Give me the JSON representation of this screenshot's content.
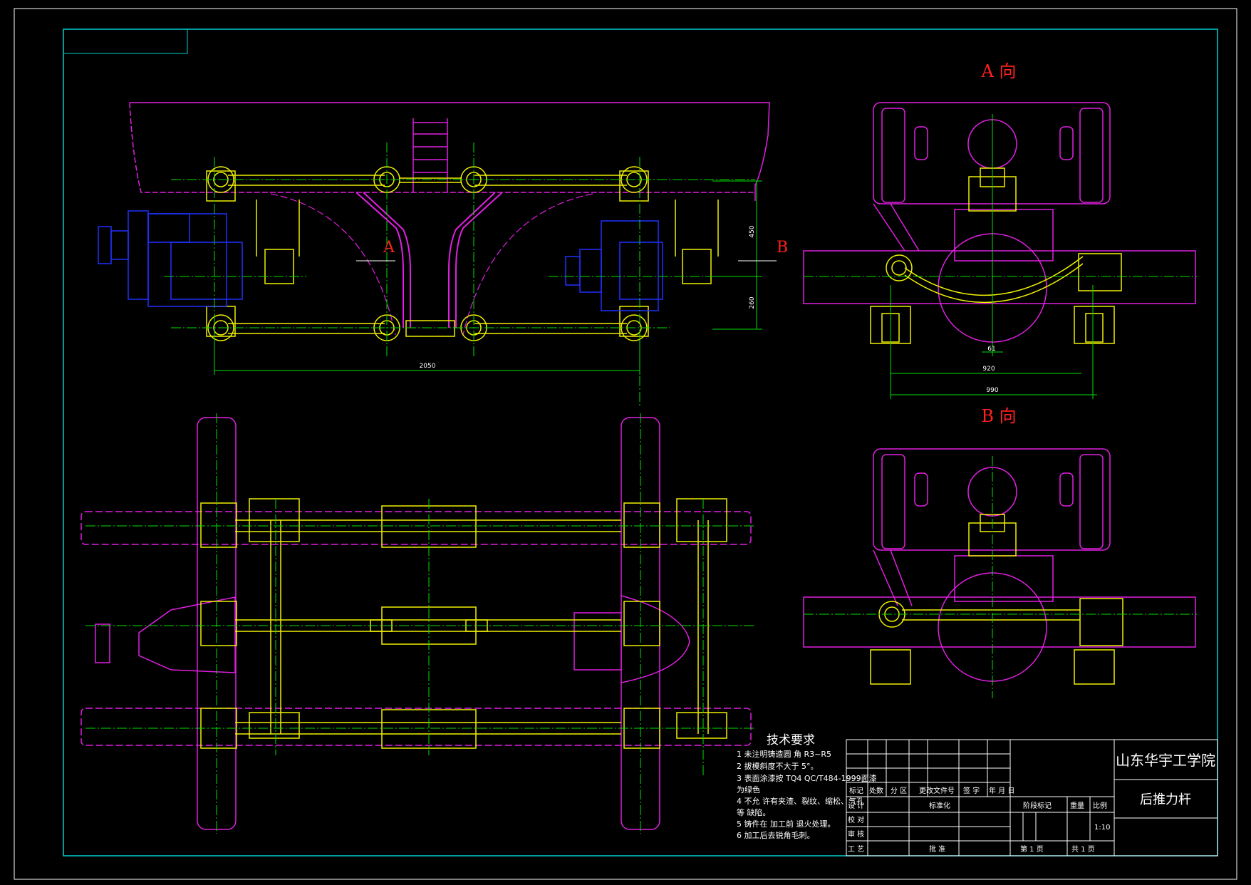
{
  "sheet": {
    "school": "山东华宇工学院",
    "part_name": "后推力杆",
    "scale": "1:10"
  },
  "views": {
    "view_a": "A  向",
    "view_b": "B  向",
    "section_a": "A",
    "section_b": "B"
  },
  "dimensions": {
    "d_2050": "2050",
    "d_450": "450",
    "d_260": "260",
    "d_61": "61",
    "d_920": "920",
    "d_990": "990"
  },
  "tech": {
    "title": "技术要求",
    "items": [
      "1 未注明铸造圆 角 R3~R5",
      "2 拔模斜度不大于 5°。",
      "3 表面涂漆按 TQ4 QC/T484-1999面漆",
      "为绿色",
      "4 不允 许有夹渣、裂纹、缩松、气孔",
      "等 缺陷。",
      "5 铸件在 加工前 退火处理。",
      "6 加工后去锐角毛刺。"
    ]
  },
  "title_block": {
    "rev_headers": [
      "标记",
      "处数",
      "分 区",
      "更改文件号",
      "签 字",
      "年 月 日"
    ],
    "roles": [
      "设 计",
      "校 对",
      "审 核",
      "工 艺"
    ],
    "std": "标准化",
    "approve": "批 准",
    "stage": "阶段标记",
    "weight": "重量",
    "scale_h": "比例",
    "sheet_no": "第  1  页",
    "sheet_total": "共  1  页"
  },
  "colors": {
    "frame": "#00d0d0",
    "magenta": "#e020e0",
    "yellow": "#f0f000",
    "green": "#00e000",
    "blue": "#2030ff",
    "red": "#ff2020",
    "white": "#ffffff"
  }
}
